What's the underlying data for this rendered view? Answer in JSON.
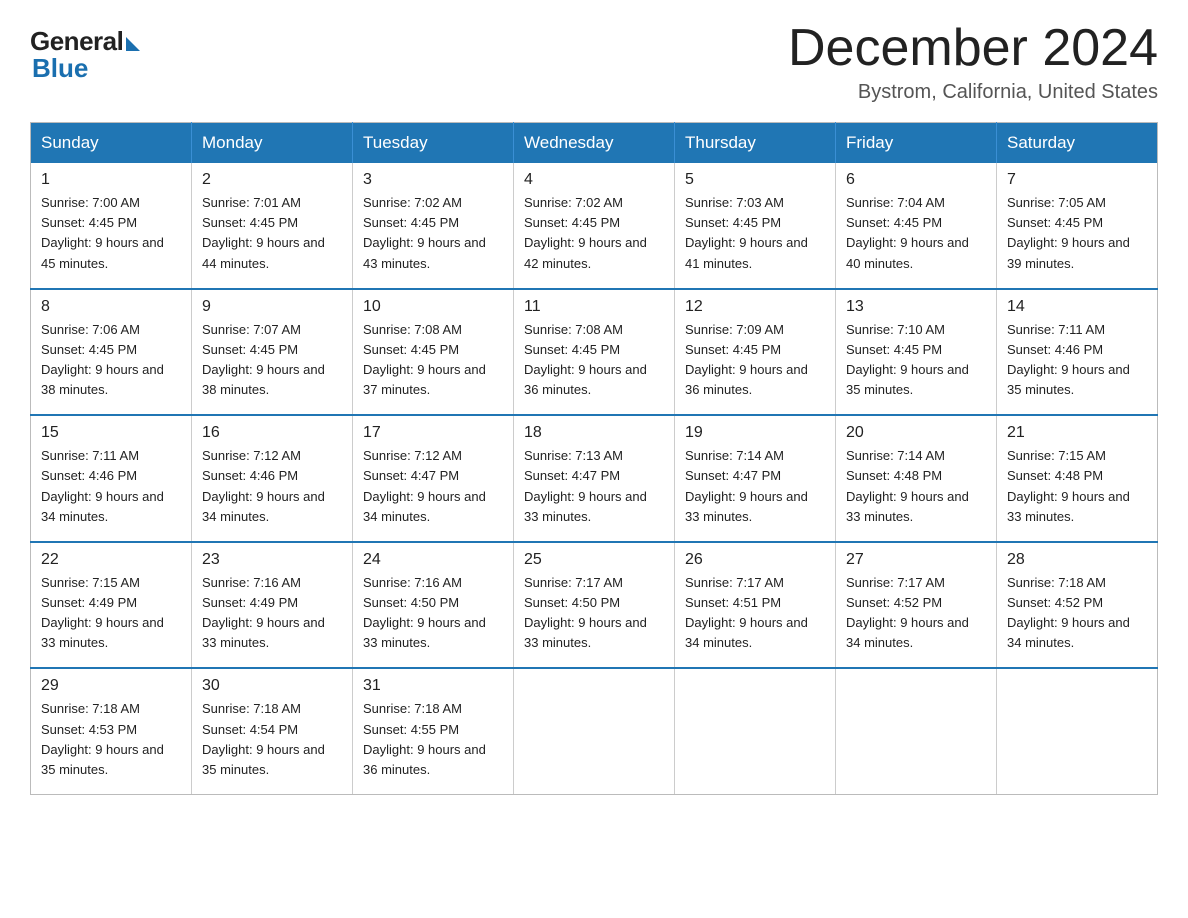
{
  "logo": {
    "general": "General",
    "blue": "Blue"
  },
  "header": {
    "month": "December 2024",
    "location": "Bystrom, California, United States"
  },
  "days_of_week": [
    "Sunday",
    "Monday",
    "Tuesday",
    "Wednesday",
    "Thursday",
    "Friday",
    "Saturday"
  ],
  "weeks": [
    [
      {
        "day": "1",
        "sunrise": "7:00 AM",
        "sunset": "4:45 PM",
        "daylight": "9 hours and 45 minutes."
      },
      {
        "day": "2",
        "sunrise": "7:01 AM",
        "sunset": "4:45 PM",
        "daylight": "9 hours and 44 minutes."
      },
      {
        "day": "3",
        "sunrise": "7:02 AM",
        "sunset": "4:45 PM",
        "daylight": "9 hours and 43 minutes."
      },
      {
        "day": "4",
        "sunrise": "7:02 AM",
        "sunset": "4:45 PM",
        "daylight": "9 hours and 42 minutes."
      },
      {
        "day": "5",
        "sunrise": "7:03 AM",
        "sunset": "4:45 PM",
        "daylight": "9 hours and 41 minutes."
      },
      {
        "day": "6",
        "sunrise": "7:04 AM",
        "sunset": "4:45 PM",
        "daylight": "9 hours and 40 minutes."
      },
      {
        "day": "7",
        "sunrise": "7:05 AM",
        "sunset": "4:45 PM",
        "daylight": "9 hours and 39 minutes."
      }
    ],
    [
      {
        "day": "8",
        "sunrise": "7:06 AM",
        "sunset": "4:45 PM",
        "daylight": "9 hours and 38 minutes."
      },
      {
        "day": "9",
        "sunrise": "7:07 AM",
        "sunset": "4:45 PM",
        "daylight": "9 hours and 38 minutes."
      },
      {
        "day": "10",
        "sunrise": "7:08 AM",
        "sunset": "4:45 PM",
        "daylight": "9 hours and 37 minutes."
      },
      {
        "day": "11",
        "sunrise": "7:08 AM",
        "sunset": "4:45 PM",
        "daylight": "9 hours and 36 minutes."
      },
      {
        "day": "12",
        "sunrise": "7:09 AM",
        "sunset": "4:45 PM",
        "daylight": "9 hours and 36 minutes."
      },
      {
        "day": "13",
        "sunrise": "7:10 AM",
        "sunset": "4:45 PM",
        "daylight": "9 hours and 35 minutes."
      },
      {
        "day": "14",
        "sunrise": "7:11 AM",
        "sunset": "4:46 PM",
        "daylight": "9 hours and 35 minutes."
      }
    ],
    [
      {
        "day": "15",
        "sunrise": "7:11 AM",
        "sunset": "4:46 PM",
        "daylight": "9 hours and 34 minutes."
      },
      {
        "day": "16",
        "sunrise": "7:12 AM",
        "sunset": "4:46 PM",
        "daylight": "9 hours and 34 minutes."
      },
      {
        "day": "17",
        "sunrise": "7:12 AM",
        "sunset": "4:47 PM",
        "daylight": "9 hours and 34 minutes."
      },
      {
        "day": "18",
        "sunrise": "7:13 AM",
        "sunset": "4:47 PM",
        "daylight": "9 hours and 33 minutes."
      },
      {
        "day": "19",
        "sunrise": "7:14 AM",
        "sunset": "4:47 PM",
        "daylight": "9 hours and 33 minutes."
      },
      {
        "day": "20",
        "sunrise": "7:14 AM",
        "sunset": "4:48 PM",
        "daylight": "9 hours and 33 minutes."
      },
      {
        "day": "21",
        "sunrise": "7:15 AM",
        "sunset": "4:48 PM",
        "daylight": "9 hours and 33 minutes."
      }
    ],
    [
      {
        "day": "22",
        "sunrise": "7:15 AM",
        "sunset": "4:49 PM",
        "daylight": "9 hours and 33 minutes."
      },
      {
        "day": "23",
        "sunrise": "7:16 AM",
        "sunset": "4:49 PM",
        "daylight": "9 hours and 33 minutes."
      },
      {
        "day": "24",
        "sunrise": "7:16 AM",
        "sunset": "4:50 PM",
        "daylight": "9 hours and 33 minutes."
      },
      {
        "day": "25",
        "sunrise": "7:17 AM",
        "sunset": "4:50 PM",
        "daylight": "9 hours and 33 minutes."
      },
      {
        "day": "26",
        "sunrise": "7:17 AM",
        "sunset": "4:51 PM",
        "daylight": "9 hours and 34 minutes."
      },
      {
        "day": "27",
        "sunrise": "7:17 AM",
        "sunset": "4:52 PM",
        "daylight": "9 hours and 34 minutes."
      },
      {
        "day": "28",
        "sunrise": "7:18 AM",
        "sunset": "4:52 PM",
        "daylight": "9 hours and 34 minutes."
      }
    ],
    [
      {
        "day": "29",
        "sunrise": "7:18 AM",
        "sunset": "4:53 PM",
        "daylight": "9 hours and 35 minutes."
      },
      {
        "day": "30",
        "sunrise": "7:18 AM",
        "sunset": "4:54 PM",
        "daylight": "9 hours and 35 minutes."
      },
      {
        "day": "31",
        "sunrise": "7:18 AM",
        "sunset": "4:55 PM",
        "daylight": "9 hours and 36 minutes."
      },
      null,
      null,
      null,
      null
    ]
  ]
}
